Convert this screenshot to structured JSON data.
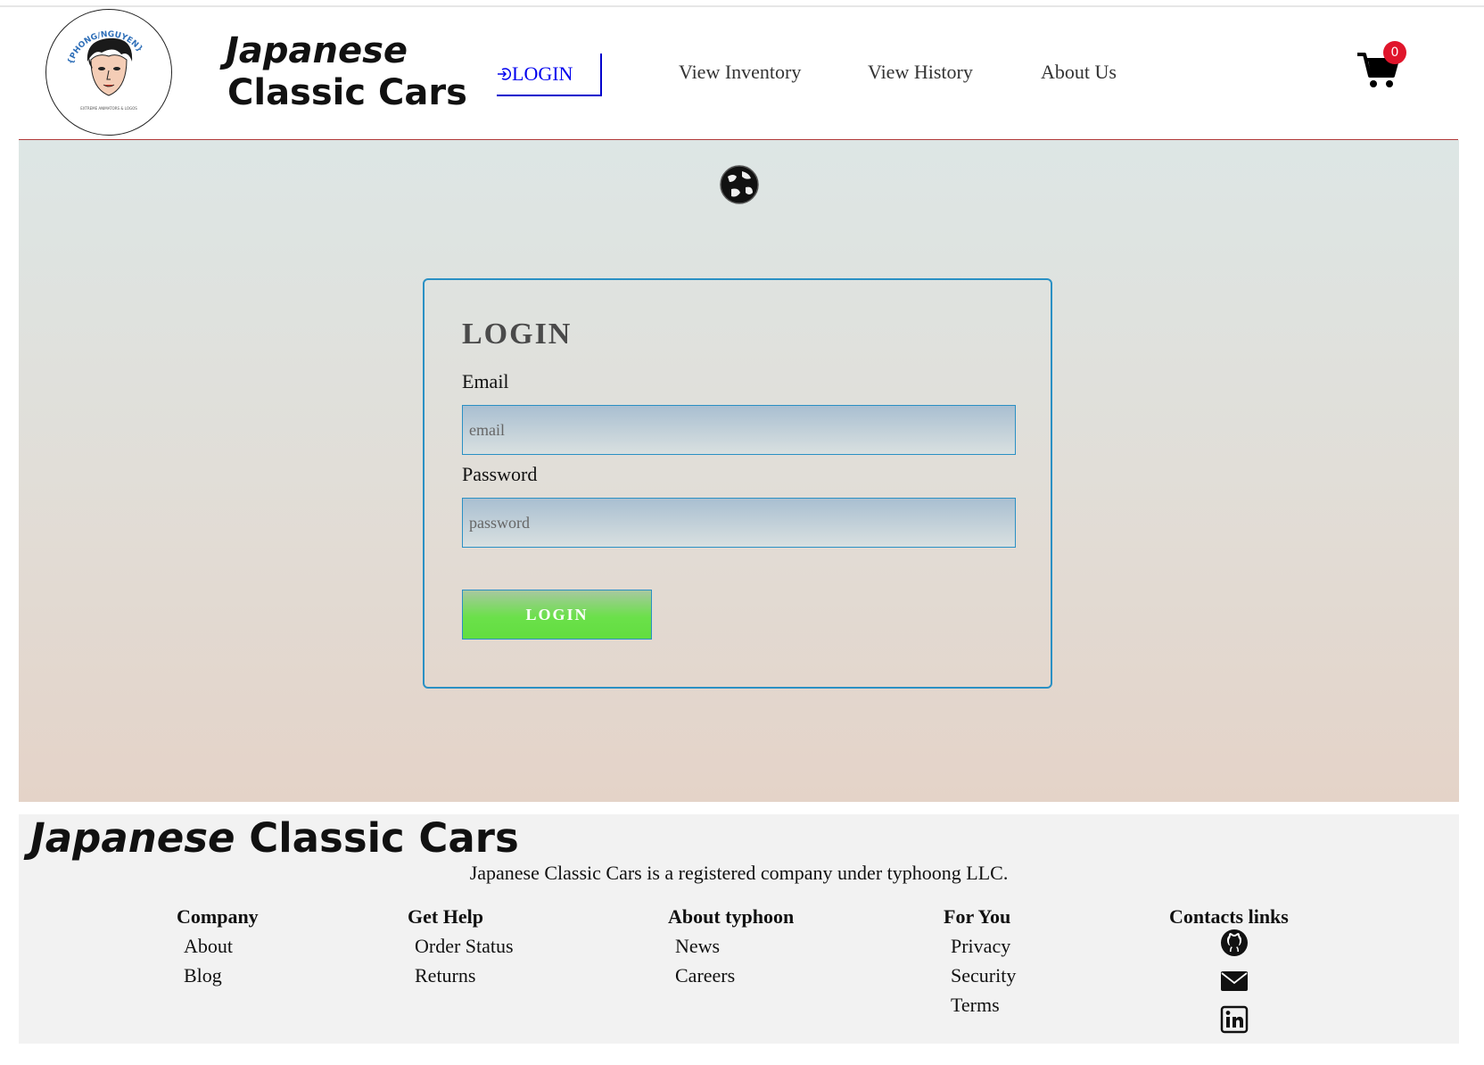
{
  "header": {
    "logo_icon": "cartoon-avatar-logo",
    "logo_ring_text": "{PHONG/NGUYEN}",
    "logo_caption": "EXTREME ANIMATORS & LOGOS",
    "brand_line1": "Japanese",
    "brand_line2": "Classic Cars",
    "login_link": "LOGIN",
    "login_icon": "login-icon",
    "nav": {
      "inventory": "View Inventory",
      "history": "View History",
      "about": "About Us"
    },
    "cart_icon": "cart-icon",
    "cart_count": "0",
    "colors": {
      "link": "#0000ee",
      "badge": "#e0152b",
      "rule": "#b23a3a"
    }
  },
  "main": {
    "globe_icon": "globe-icon",
    "form": {
      "title": "LOGIN",
      "email_label": "Email",
      "email_placeholder": "email",
      "password_label": "Password",
      "password_placeholder": "password",
      "submit_label": "LOGIN"
    },
    "colors": {
      "card_border": "#2a90c4",
      "button": "#62de40"
    }
  },
  "footer": {
    "brand_italic": "Japanese",
    "brand_rest": "Classic Cars",
    "note": "Japanese Classic Cars is a registered company under typhoong LLC.",
    "columns": [
      {
        "title": "Company",
        "links": [
          "About",
          "Blog"
        ]
      },
      {
        "title": "Get Help",
        "links": [
          "Order Status",
          "Returns"
        ]
      },
      {
        "title": "About typhoon",
        "links": [
          "News",
          "Careers"
        ]
      },
      {
        "title": "For You",
        "links": [
          "Privacy",
          "Security",
          "Terms"
        ]
      },
      {
        "title": "Contacts links",
        "icons": [
          "github-icon",
          "email-icon",
          "linkedin-icon"
        ]
      }
    ]
  }
}
